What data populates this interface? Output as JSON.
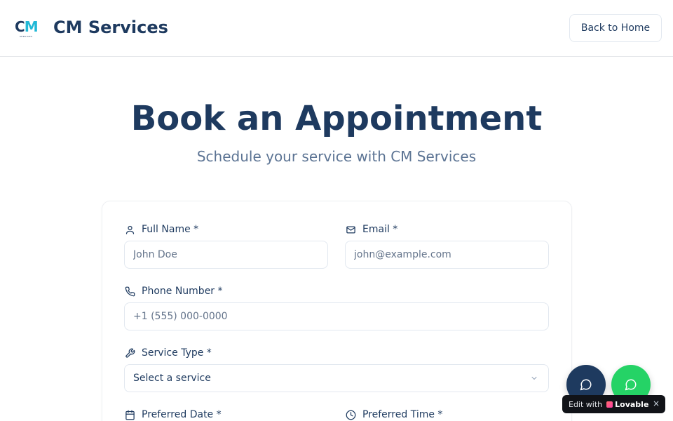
{
  "header": {
    "logo_text_c": "C",
    "logo_text_m": "M",
    "logo_small": "SERVICES",
    "brand": "CM Services",
    "back_button": "Back to Home"
  },
  "hero": {
    "title": "Book an Appointment",
    "subtitle": "Schedule your service with CM Services"
  },
  "form": {
    "full_name": {
      "label": "Full Name *",
      "placeholder": "John Doe",
      "icon": "user-icon"
    },
    "email": {
      "label": "Email *",
      "placeholder": "john@example.com",
      "icon": "mail-icon"
    },
    "phone": {
      "label": "Phone Number *",
      "placeholder": "+1 (555) 000-0000",
      "icon": "phone-icon"
    },
    "service_type": {
      "label": "Service Type *",
      "value": "Select a service",
      "icon": "wrench-icon"
    },
    "preferred_date": {
      "label": "Preferred Date *",
      "icon": "calendar-icon"
    },
    "preferred_time": {
      "label": "Preferred Time *",
      "icon": "clock-icon"
    }
  },
  "floating": {
    "chat_icon": "chat-bubble-icon",
    "whatsapp_icon": "whatsapp-icon",
    "chat_color": "#1e3a5f",
    "whatsapp_color": "#25d366"
  },
  "badge": {
    "prefix": "Edit with",
    "brand": "Lovable",
    "close": "×"
  },
  "colors": {
    "primary": "#1e3a5f",
    "accent": "#22b8d6",
    "muted": "#5b7393"
  }
}
